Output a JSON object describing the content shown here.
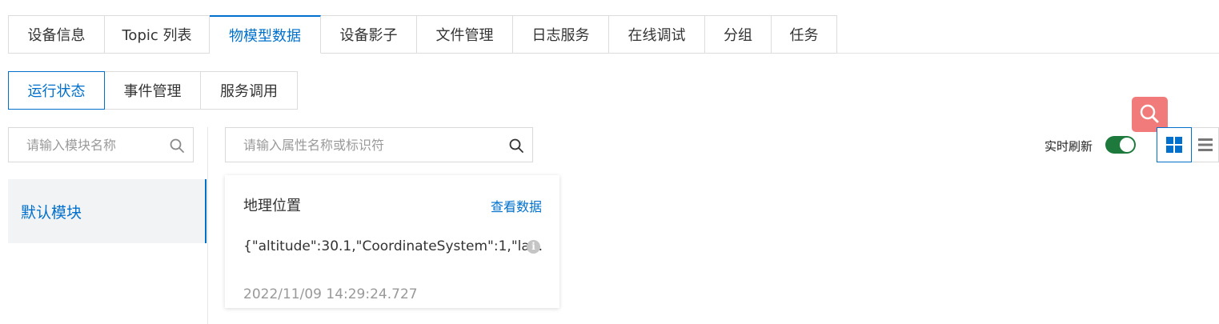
{
  "top_tabs": [
    {
      "label": "设备信息"
    },
    {
      "label": "Topic 列表"
    },
    {
      "label": "物模型数据"
    },
    {
      "label": "设备影子"
    },
    {
      "label": "文件管理"
    },
    {
      "label": "日志服务"
    },
    {
      "label": "在线调试"
    },
    {
      "label": "分组"
    },
    {
      "label": "任务"
    }
  ],
  "sub_tabs": [
    {
      "label": "运行状态"
    },
    {
      "label": "事件管理"
    },
    {
      "label": "服务调用"
    }
  ],
  "module_search": {
    "placeholder": "请输入模块名称"
  },
  "modules": [
    {
      "label": "默认模块"
    }
  ],
  "property_search": {
    "placeholder": "请输入属性名称或标识符"
  },
  "realtime_refresh": {
    "label": "实时刷新",
    "enabled": true
  },
  "card": {
    "title": "地理位置",
    "link": "查看数据",
    "value": "{\"altitude\":30.1,\"CoordinateSystem\":1,\"la...",
    "timestamp": "2022/11/09 14:29:24.727"
  },
  "icons": {
    "search": "search-icon",
    "info": "info-icon",
    "grid_view": "grid-view-icon",
    "list_view": "list-view-icon",
    "floating_search": "magnifier-icon"
  },
  "colors": {
    "accent": "#0070cc",
    "toggle_on": "#1e7a3c",
    "fab": "#f17b7b"
  }
}
